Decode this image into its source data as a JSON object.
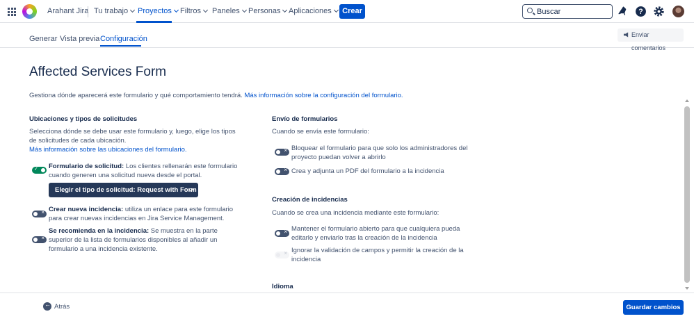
{
  "topnav": {
    "site_name": "Arahant Jira",
    "menu": [
      "Tu trabajo",
      "Proyectos",
      "Filtros",
      "Paneles",
      "Personas",
      "Aplicaciones"
    ],
    "create_label": "Crear",
    "search_placeholder": "Buscar",
    "icons": [
      "apps-grid-icon",
      "notifications-icon",
      "help-icon",
      "settings-icon",
      "avatar"
    ]
  },
  "subtabs": {
    "items": [
      "Generar",
      "Vista previa",
      "Configuración"
    ],
    "active": "Configuración",
    "feedback_label": "Enviar comentarios"
  },
  "main": {
    "title": "Affected Services Form",
    "intro_text": "Gestiona dónde aparecerá este formulario y qué comportamiento tendrá. ",
    "intro_link": "Más información sobre la configuración del formulario."
  },
  "locations": {
    "title": "Ubicaciones y tipos de solicitudes",
    "desc_line1": "Selecciona dónde se debe usar este formulario y, luego, elige los tipos",
    "desc_line2": "de solicitudes de cada ubicación.",
    "link": "Más información sobre las ubicaciones del formulario.",
    "options": [
      {
        "label": "Formulario de solicitud:",
        "text1": " Los clientes rellenarán este formulario",
        "text2": "cuando generen una solicitud nueva desde el portal.",
        "enabled": true
      },
      {
        "label": "Crear nueva incidencia:",
        "text1": " utiliza un enlace para este formulario",
        "text2": "para crear nuevas incidencias en Jira Service Management.",
        "enabled": false
      },
      {
        "label": "Se recomienda en la incidencia:",
        "text1": " Se muestra en la parte",
        "text2": "superior de la lista de formularios disponibles al añadir un",
        "text3": "formulario a una incidencia existente.",
        "enabled": false
      }
    ],
    "request_type_button": "Elegir el tipo de solicitud: Request with Form"
  },
  "submission": {
    "title": "Envío de formularios",
    "desc": "Cuando se envía este formulario:",
    "options": [
      {
        "line1": "Bloquear el formulario para que solo los administradores del",
        "line2": "proyecto puedan volver a abrirlo",
        "enabled": false
      },
      {
        "line1": "Crea y adjunta un PDF del formulario a la incidencia",
        "enabled": false
      }
    ]
  },
  "issue_creation": {
    "title": "Creación de incidencias",
    "desc": "Cuando se crea una incidencia mediante este formulario:",
    "options": [
      {
        "line1": "Mantener el formulario abierto para que cualquiera pueda",
        "line2": "editarlo y enviarlo tras la creación de la incidencia",
        "enabled": false
      },
      {
        "line1": "Ignorar la validación de campos y permitir la creación de la",
        "line2": "incidencia",
        "enabled": false,
        "disabled": true
      }
    ]
  },
  "language": {
    "title": "Idioma"
  },
  "footer": {
    "back_label": "Atrás",
    "save_label": "Guardar cambios"
  },
  "colors": {
    "accent": "#0052cc",
    "toggle_on": "#00875a",
    "toggle_off": "#42526e",
    "dark_button": "#253858"
  }
}
